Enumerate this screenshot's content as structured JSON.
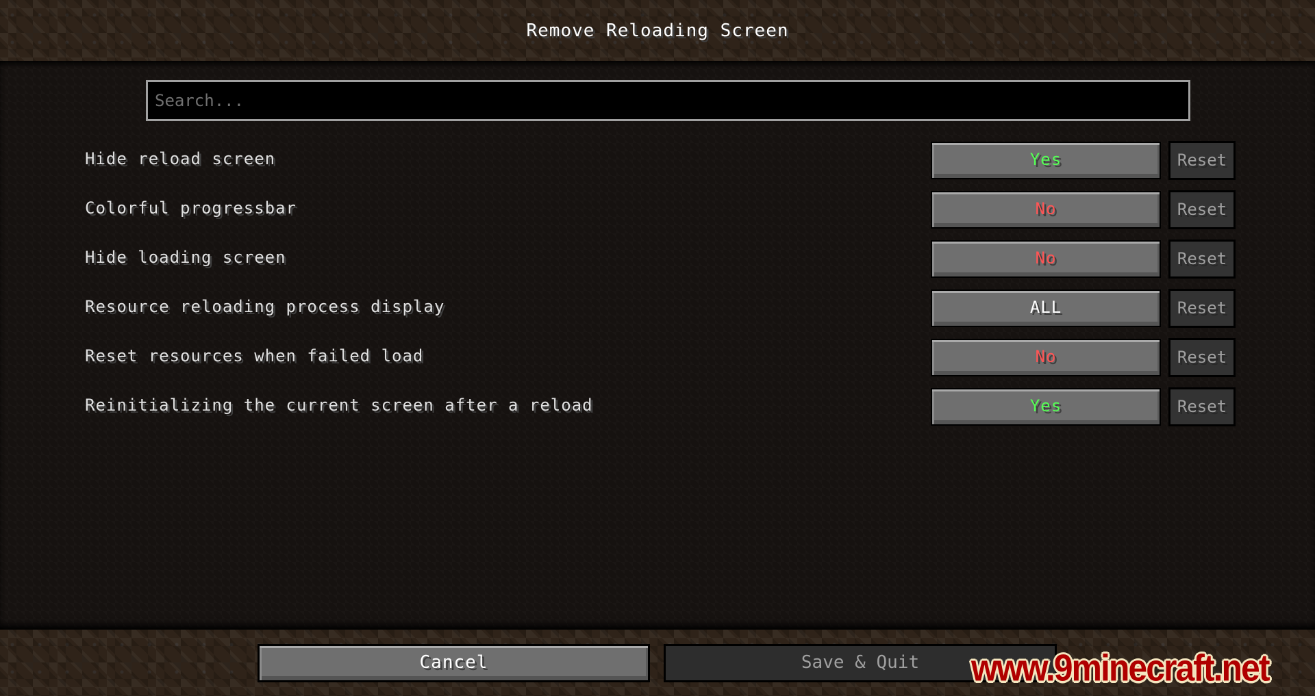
{
  "header": {
    "title": "Remove Reloading Screen"
  },
  "search": {
    "placeholder": "Search...",
    "value": ""
  },
  "settings": [
    {
      "label": "Hide reload screen",
      "value": "Yes",
      "value_color": "#55ff55",
      "reset_label": "Reset"
    },
    {
      "label": "Colorful progressbar",
      "value": "No",
      "value_color": "#ff5555",
      "reset_label": "Reset"
    },
    {
      "label": "Hide loading screen",
      "value": "No",
      "value_color": "#ff5555",
      "reset_label": "Reset"
    },
    {
      "label": "Resource reloading process display",
      "value": "ALL",
      "value_color": "#ffffff",
      "reset_label": "Reset"
    },
    {
      "label": "Reset resources when failed load",
      "value": "No",
      "value_color": "#ff5555",
      "reset_label": "Reset"
    },
    {
      "label": "Reinitializing the current screen after a reload",
      "value": "Yes",
      "value_color": "#55ff55",
      "reset_label": "Reset"
    }
  ],
  "footer": {
    "cancel_label": "Cancel",
    "save_label": "Save & Quit"
  },
  "watermark": {
    "text": "www.9minecraft.net",
    "color": "#b00000"
  }
}
